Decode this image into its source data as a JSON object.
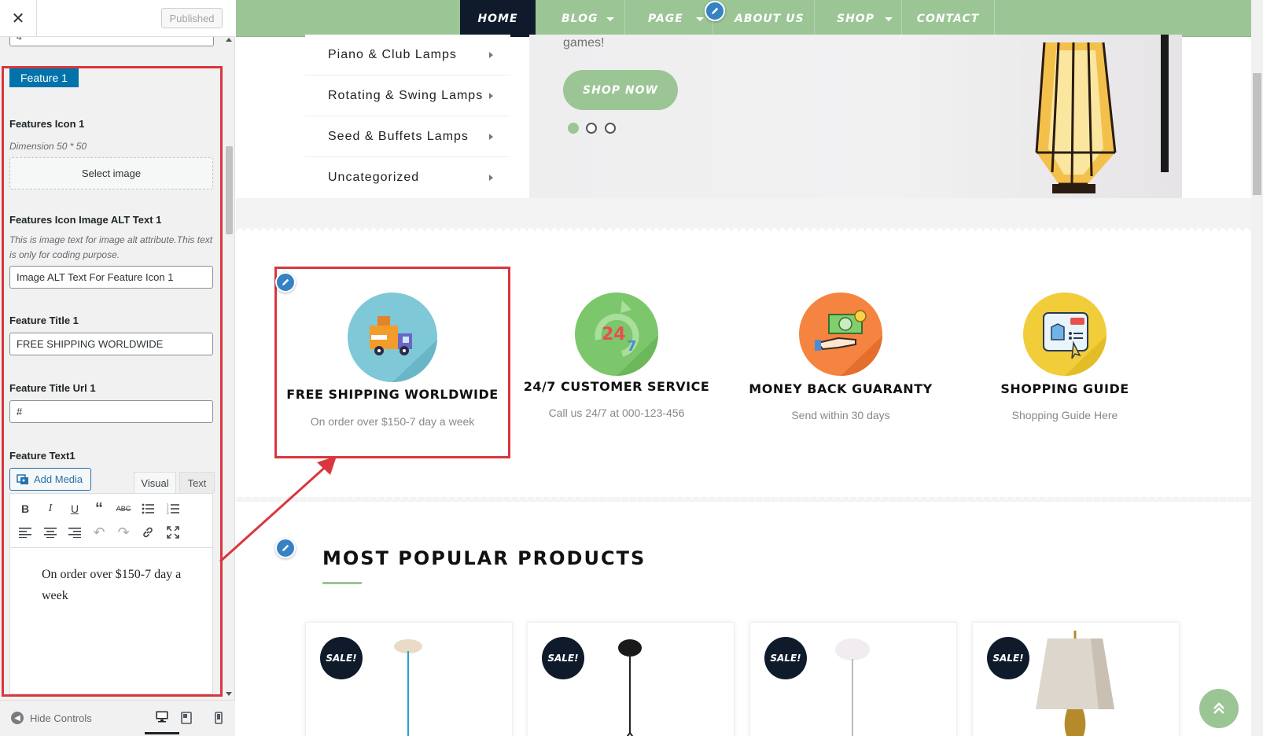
{
  "customizer": {
    "close_label": "✕",
    "published_label": "Published",
    "partial_input_value": "4",
    "feature_tag": "Feature 1",
    "icon_label": "Features Icon 1",
    "icon_desc": "Dimension 50 * 50",
    "select_image_label": "Select image",
    "alt_label": "Features Icon Image ALT Text 1",
    "alt_desc": "This is image text for image alt attribute.This text is only for coding purpose.",
    "alt_value": "Image ALT Text For Feature Icon 1",
    "title_label": "Feature Title 1",
    "title_value": "FREE SHIPPING WORLDWIDE",
    "url_label": "Feature Title Url 1",
    "url_value": "#",
    "text_label": "Feature Text1",
    "add_media_label": "Add Media",
    "tab_visual": "Visual",
    "tab_text": "Text",
    "editor_content": "On order over $150-7 day a week",
    "hide_controls_label": "Hide Controls"
  },
  "nav": {
    "items": [
      {
        "label": "HOME"
      },
      {
        "label": "BLOG"
      },
      {
        "label": "PAGE"
      },
      {
        "label": "ABOUT US"
      },
      {
        "label": "SHOP"
      },
      {
        "label": "CONTACT"
      }
    ]
  },
  "categories": [
    "Piano & Club Lamps",
    "Rotating & Swing Lamps",
    "Seed & Buffets Lamps",
    "Uncategorized"
  ],
  "slider": {
    "text": "games!",
    "button": "SHOP NOW",
    "prev": "‹",
    "next": "›"
  },
  "features": [
    {
      "title": "FREE SHIPPING WORLDWIDE",
      "text": "On order over $150-7 day a week",
      "color": "#7ec8d8"
    },
    {
      "title": "24/7 CUSTOMER SERVICE",
      "text": "Call us 24/7 at 000-123-456",
      "color": "#7cc66b"
    },
    {
      "title": "MONEY BACK GUARANTY",
      "text": "Send within 30 days",
      "color": "#f4843f"
    },
    {
      "title": "SHOPPING GUIDE",
      "text": "Shopping Guide Here",
      "color": "#f1cd3a"
    }
  ],
  "popular": {
    "title": "MOST POPULAR PRODUCTS",
    "sale_badge": "SALE!"
  },
  "colors": {
    "accent_green": "#9bc595",
    "wp_blue": "#0073aa",
    "highlight_red": "#d9363e",
    "nav_active": "#0f1b2b"
  }
}
